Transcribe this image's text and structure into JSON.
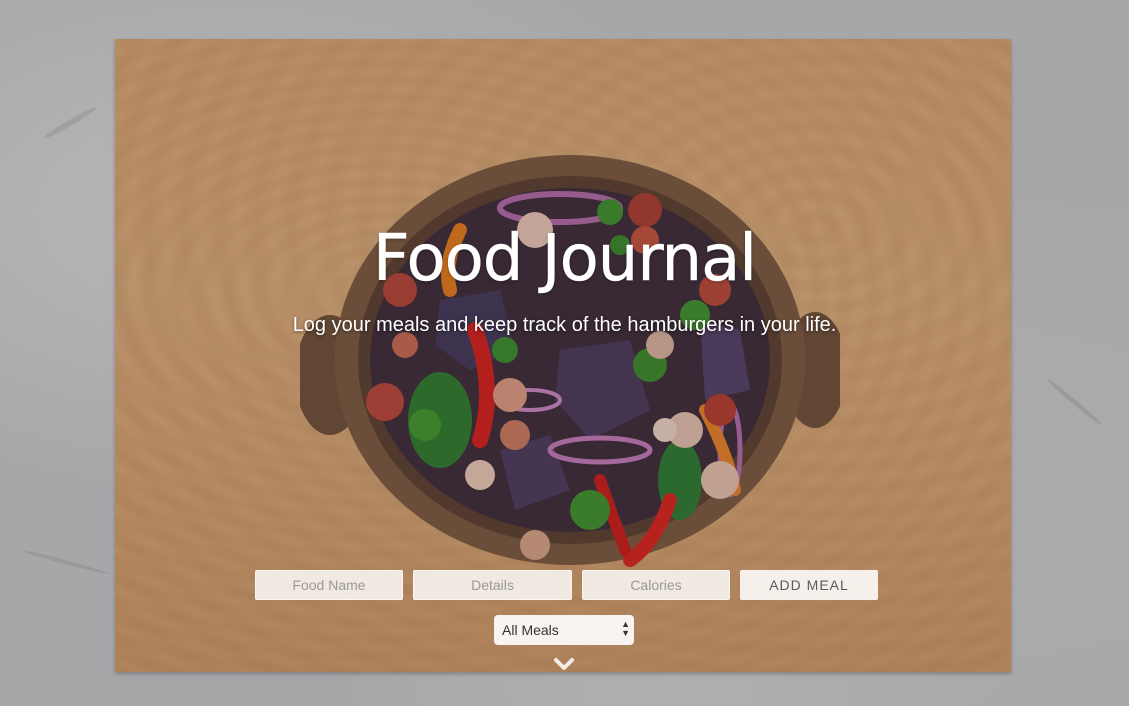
{
  "hero": {
    "title": "Food Journal",
    "subtitle": "Log your meals and keep track of the hamburgers in your life."
  },
  "form": {
    "food_name_placeholder": "Food Name",
    "details_placeholder": "Details",
    "calories_placeholder": "Calories",
    "add_button_label": "ADD MEAL"
  },
  "filter": {
    "selected": "All Meals"
  },
  "icons": {
    "scroll_down": "chevron-down-icon",
    "select_arrows": "select-arrows-icon"
  },
  "colors": {
    "board_wood": "#d9a877",
    "marble": "#c4c6c9",
    "text": "#ffffff"
  }
}
